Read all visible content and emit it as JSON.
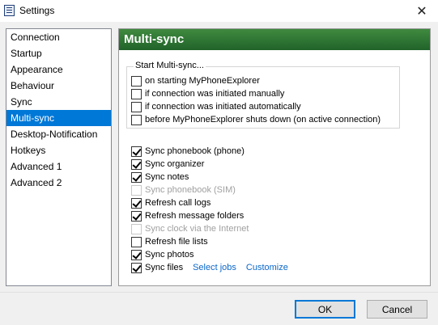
{
  "window": {
    "title": "Settings",
    "close_glyph": "✕",
    "icon": "settings-app-icon"
  },
  "nav": {
    "items": [
      {
        "label": "Connection",
        "selected": false
      },
      {
        "label": "Startup",
        "selected": false
      },
      {
        "label": "Appearance",
        "selected": false
      },
      {
        "label": "Behaviour",
        "selected": false
      },
      {
        "label": "Sync",
        "selected": false
      },
      {
        "label": "Multi-sync",
        "selected": true
      },
      {
        "label": "Desktop-Notification",
        "selected": false
      },
      {
        "label": "Hotkeys",
        "selected": false
      },
      {
        "label": "Advanced 1",
        "selected": false
      },
      {
        "label": "Advanced 2",
        "selected": false
      }
    ]
  },
  "panel": {
    "title": "Multi-sync",
    "start_group": {
      "title": "Start Multi-sync...",
      "options": [
        {
          "label": "on starting MyPhoneExplorer",
          "checked": false
        },
        {
          "label": "if connection was initiated manually",
          "checked": false
        },
        {
          "label": "if connection was initiated automatically",
          "checked": false
        },
        {
          "label": "before MyPhoneExplorer shuts down (on active connection)",
          "checked": false
        }
      ]
    },
    "sync_options": [
      {
        "label": "Sync phonebook (phone)",
        "checked": true,
        "disabled": false
      },
      {
        "label": "Sync organizer",
        "checked": true,
        "disabled": false
      },
      {
        "label": "Sync notes",
        "checked": true,
        "disabled": false
      },
      {
        "label": "Sync phonebook (SIM)",
        "checked": false,
        "disabled": true
      },
      {
        "label": "Refresh call logs",
        "checked": true,
        "disabled": false
      },
      {
        "label": "Refresh message folders",
        "checked": true,
        "disabled": false
      },
      {
        "label": "Sync clock via the Internet",
        "checked": false,
        "disabled": true
      },
      {
        "label": "Refresh file lists",
        "checked": false,
        "disabled": false
      },
      {
        "label": "Sync photos",
        "checked": true,
        "disabled": false
      },
      {
        "label": "Sync files",
        "checked": true,
        "disabled": false
      }
    ],
    "links": {
      "select_jobs": "Select jobs",
      "customize": "Customize"
    }
  },
  "buttons": {
    "ok": "OK",
    "cancel": "Cancel"
  },
  "colors": {
    "selection": "#0078d7",
    "header_green": "#2a6e30",
    "link": "#0a67c9"
  }
}
